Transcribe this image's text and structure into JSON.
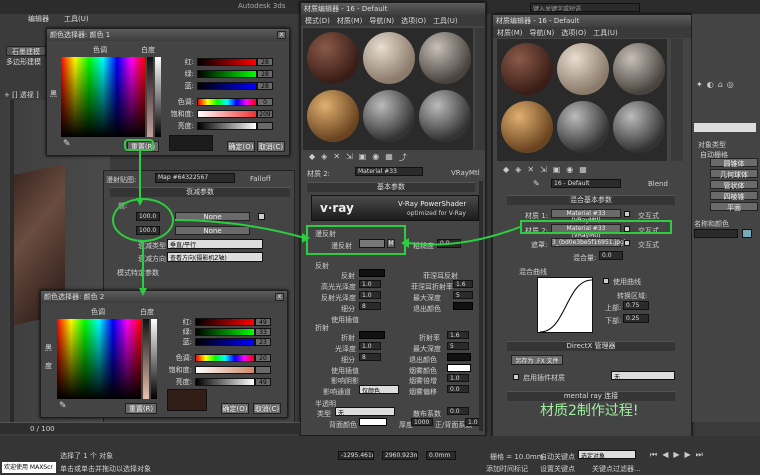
{
  "app": {
    "title_fragment": "Autodesk 3ds"
  },
  "left_strip": {
    "tabs": [
      "编辑器",
      "工具(U)"
    ],
    "items": [
      "石墨建模",
      "多边形建模"
    ],
    "viewport_label": "+ [] 透视 ]"
  },
  "picker1": {
    "title": "颜色选择器: 颜色 1",
    "col_hue": "色调",
    "col_white": "白度",
    "black": "黑",
    "labels": [
      "红:",
      "绿:",
      "蓝:",
      "色调:",
      "饱和度:",
      "亮度:"
    ],
    "values": [
      "28",
      "28",
      "28",
      "0",
      "209",
      ""
    ],
    "reset": "重置(R)",
    "ok": "确定(O)",
    "cancel": "取消(C)"
  },
  "picker2": {
    "title": "颜色选择器: 颜色 2",
    "col_hue": "色调",
    "col_white": "白度",
    "black": "黑",
    "side": "度",
    "labels": [
      "红:",
      "绿:",
      "蓝:",
      "色调:",
      "饱和度:",
      "亮度:"
    ],
    "values": [
      "49",
      "33",
      "23",
      "20",
      "",
      "49"
    ],
    "reset": "重置(R)",
    "ok": "确定(O)",
    "cancel": "取消(C)"
  },
  "middle_editor_left": {
    "map_label": "漫射贴图:",
    "map_name": "Map #64322567",
    "map_type": "Falloff",
    "params_title": "衰减参数",
    "rows": [
      {
        "label": "前:",
        "value": "100.0",
        "none": "None"
      },
      {
        "label": "",
        "value": "100.0",
        "none": "None"
      }
    ],
    "falloff_type_label": "衰减类型:",
    "falloff_type": "垂直/平行",
    "falloff_dir_label": "衰减方向:",
    "falloff_dir": "查看方向(摄影机Z轴)",
    "mode_label": "模式特定参数"
  },
  "editor2": {
    "title": "材质编辑器 - 16 - Default",
    "menu": [
      "模式(D)",
      "材质(M)",
      "导航(N)",
      "选项(O)",
      "工具(U)"
    ],
    "mat_label": "材质 2:",
    "mat_name": "Material #33",
    "mat_type": "VRayMtl",
    "basic_params": "基本参数",
    "vray_line1": "V-Ray PowerShader",
    "vray_line2": "optimized for V-Ray",
    "vray_logo": "v·ray",
    "diffuse_group": "漫反射",
    "diffuse_label": "漫反射",
    "roughness_label": "粗糙度",
    "roughness": "0.0",
    "reflection_group": "反射",
    "refl_labels": [
      "反射",
      "高光光泽度",
      "反射光泽度",
      "细分",
      "使用插值"
    ],
    "refl_vals": [
      "",
      "1.0",
      "1.0",
      "8",
      ""
    ],
    "refl_right": [
      "菲涅耳反射",
      "菲涅耳折射率",
      "最大深度",
      "退出颜色"
    ],
    "refl_right_vals": [
      "",
      "1.6",
      "5",
      ""
    ],
    "refraction_group": "折射",
    "refr_labels": [
      "折射",
      "光泽度",
      "细分",
      "使用插值",
      "影响阴影",
      "影响通道"
    ],
    "refr_vals": [
      "",
      "1.0",
      "8",
      "",
      "",
      "仅颜色"
    ],
    "refr_right": [
      "折射率",
      "最大深度",
      "退出颜色",
      "烟雾颜色",
      "烟雾倍增",
      "烟雾偏移"
    ],
    "refr_right_vals": [
      "1.6",
      "5",
      "",
      "",
      "1.0",
      "0.0"
    ],
    "translucency_group": "半透明",
    "type_label": "类型",
    "type_value": "无",
    "backface_label": "背面颜色",
    "scatter_label": "散布系数",
    "fb_label": "正/背面系数",
    "scatter_val": "0.0",
    "fb_val": "1.0",
    "thickness_label": "厚度",
    "thickness_val": "1000"
  },
  "editor3": {
    "title": "材质编辑器 - 16 - Default",
    "menu": [
      "材质(M)",
      "导航(N)",
      "选项(O)",
      "工具(U)"
    ],
    "mat_name": "16 - Default",
    "mat_type": "Blend",
    "blend_params": "混合基本参数",
    "mat1_label": "材质 1:",
    "mat1": "Material #33 (VRayMtl)",
    "mat2_label": "材质 2:",
    "mat2": "Material #33 (VRayMtl)",
    "mask_label": "遮罩:",
    "mask": "3_(bd0e3be5f16951.jpg)",
    "interactive": "交互式",
    "mix_amount_label": "混合量:",
    "mix_amount": "0.0",
    "mix_curve": "混合曲线",
    "use_curve": "使用曲线",
    "transition": "转换区域:",
    "upper_label": "上部:",
    "upper": "0.75",
    "lower_label": "下部:",
    "lower": "0.25",
    "directx": "DirectX 管理器",
    "save_fx": "另存为 .FX 文件",
    "enable_plugin": "启用插件材质",
    "plugin_value": "无",
    "mental_ray": "mental ray 连接"
  },
  "right_panel": {
    "search": "键入关键字或短语",
    "object_type": "对象类型",
    "auto_grid": "自动栅格",
    "buttons": [
      "圆锥体",
      "几何球体",
      "管状体",
      "四棱锥",
      "平面"
    ],
    "name_color": "名称和颜色"
  },
  "status": {
    "selected": "选择了 1 个 对象",
    "hint": "单击或单击并拖动以选择对象",
    "welcome": "欢迎使用 MAXScr",
    "timeline": "0 / 100",
    "xcoord": "-1295.461m",
    "ycoord": "2960.923m",
    "zcoord": "0.0mm",
    "grid": "栅格 = 10.0mm",
    "auto_key": "自动关键点",
    "set_key": "设置关键点",
    "key_filter": "选定对象",
    "add_marker": "添加时间标记",
    "key_filters": "关键点过滤器..."
  },
  "annotation": "材质2制作过程!",
  "colors": {
    "accent_green": "#2ecc40",
    "annotation": "#9ff09f"
  }
}
